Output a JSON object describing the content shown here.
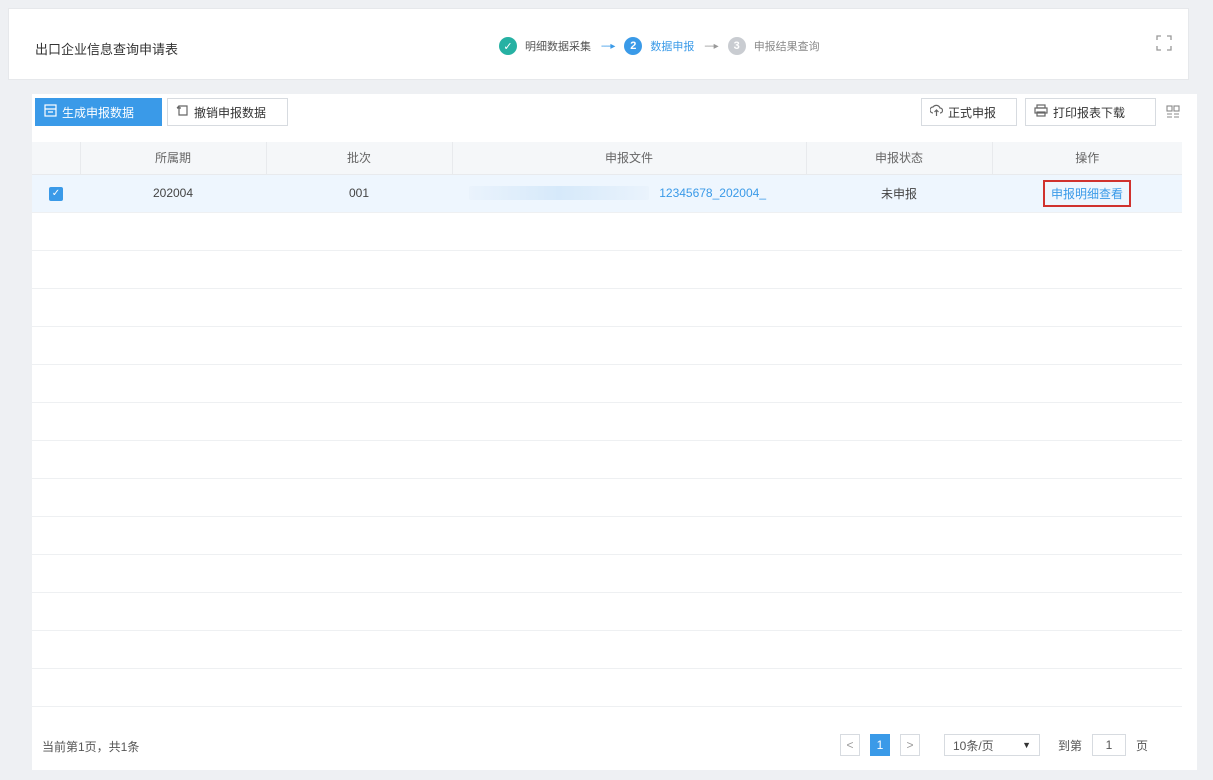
{
  "header": {
    "title": "出口企业信息查询申请表",
    "steps": [
      {
        "num": "✓",
        "label": "明细数据采集",
        "state": "done"
      },
      {
        "num": "2",
        "label": "数据申报",
        "state": "active"
      },
      {
        "num": "3",
        "label": "申报结果查询",
        "state": "pending"
      }
    ],
    "arrow": "----▸"
  },
  "toolbar": {
    "generate_label": "生成申报数据",
    "cancel_label": "撤销申报数据",
    "submit_label": "正式申报",
    "print_label": "打印报表下载"
  },
  "table": {
    "columns": [
      "",
      "所属期",
      "批次",
      "申报文件",
      "申报状态",
      "操作"
    ],
    "rows": [
      {
        "checked": true,
        "period": "202004",
        "batch": "001",
        "file": "12345678_202004_",
        "status": "未申报",
        "action": "申报明细查看"
      }
    ]
  },
  "footer": {
    "page_info": "当前第1页，共1条",
    "prev": "<",
    "current_page": "1",
    "next": ">",
    "page_size": "10条/页",
    "goto_label": "到第",
    "goto_value": "1",
    "goto_suffix": "页"
  },
  "colors": {
    "accent": "#3a9ae8",
    "done": "#26b1a3",
    "highlight_border": "#d0322e"
  }
}
